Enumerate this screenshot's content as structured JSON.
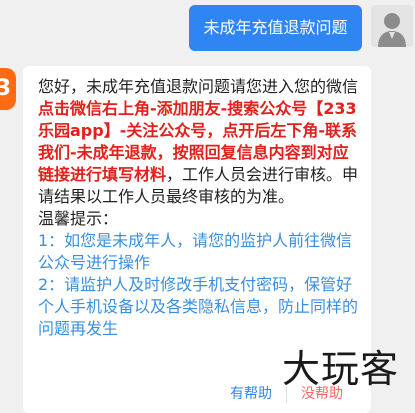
{
  "user": {
    "message": "未成年充值退款问题"
  },
  "bot": {
    "logo_text": "3",
    "intro": "您好，未成年充值退款问题请您进入您的微信",
    "instructions_highlight": "点击微信右上角-添加朋友-搜索公众号【233乐园app】-关注公众号，点开后左下角-联系我们-未成年退款，按照回复信息内容到对应链接进行填写材料",
    "after_highlight": "，工作人员会进行审核。申请结果以工作人员最终审核的为准。",
    "tips_title": "温馨提示：",
    "tips": [
      "1：如您是未成年人，请您的监护人前往微信公众号进行操作",
      "2：请监护人及时修改手机支付密码，保管好个人手机设备以及各类隐私信息，防止同样的问题再发生"
    ]
  },
  "feedback": {
    "helpful_label": "有帮助",
    "unhelpful_label": "没帮助"
  },
  "watermark": {
    "text": "大玩客"
  },
  "colors": {
    "user_bubble": "#2f86f2",
    "highlight_red": "#e3201b",
    "tip_blue": "#3b8fe0",
    "logo_orange": "#ff6a13",
    "unhelpful_red": "#ff6666"
  }
}
